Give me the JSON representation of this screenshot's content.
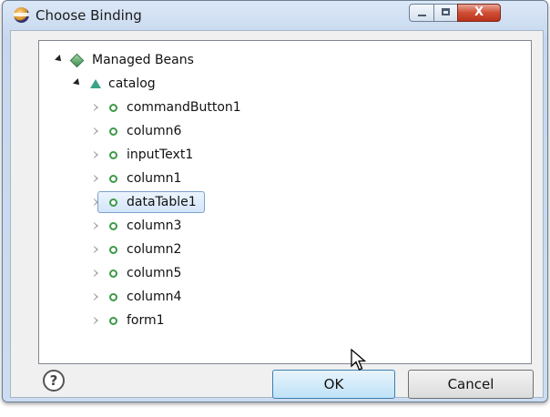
{
  "window": {
    "title": "Choose Binding",
    "close_glyph": "X"
  },
  "tree": {
    "root": {
      "label": "Managed Beans",
      "icon": "diamond-icon"
    },
    "child": {
      "label": "catalog",
      "icon": "triangle-icon"
    },
    "items": [
      {
        "label": "commandButton1",
        "selected": false
      },
      {
        "label": "column6",
        "selected": false
      },
      {
        "label": "inputText1",
        "selected": false
      },
      {
        "label": "column1",
        "selected": false
      },
      {
        "label": "dataTable1",
        "selected": true
      },
      {
        "label": "column3",
        "selected": false
      },
      {
        "label": "column2",
        "selected": false
      },
      {
        "label": "column5",
        "selected": false
      },
      {
        "label": "column4",
        "selected": false
      },
      {
        "label": "form1",
        "selected": false
      }
    ]
  },
  "buttons": {
    "help": "?",
    "ok": "OK",
    "cancel": "Cancel"
  },
  "colors": {
    "selection_border": "#7da2ce",
    "icon_green": "#3d9a48",
    "close_red": "#cf4d33"
  }
}
